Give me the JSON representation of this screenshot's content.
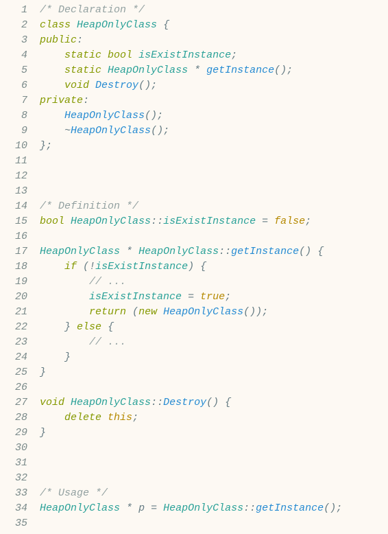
{
  "lines": [
    [
      {
        "c": "comment",
        "t": "/* Declaration */"
      }
    ],
    [
      {
        "c": "keyword",
        "t": "class"
      },
      {
        "c": "plain",
        "t": " "
      },
      {
        "c": "type",
        "t": "HeapOnlyClass"
      },
      {
        "c": "plain",
        "t": " "
      },
      {
        "c": "punct",
        "t": "{"
      }
    ],
    [
      {
        "c": "keyword",
        "t": "public"
      },
      {
        "c": "punct",
        "t": ":"
      }
    ],
    [
      {
        "c": "plain",
        "t": "    "
      },
      {
        "c": "keyword",
        "t": "static"
      },
      {
        "c": "plain",
        "t": " "
      },
      {
        "c": "keyword",
        "t": "bool"
      },
      {
        "c": "plain",
        "t": " "
      },
      {
        "c": "type",
        "t": "isExistInstance"
      },
      {
        "c": "punct",
        "t": ";"
      }
    ],
    [
      {
        "c": "plain",
        "t": "    "
      },
      {
        "c": "keyword",
        "t": "static"
      },
      {
        "c": "plain",
        "t": " "
      },
      {
        "c": "type",
        "t": "HeapOnlyClass"
      },
      {
        "c": "plain",
        "t": " "
      },
      {
        "c": "op",
        "t": "*"
      },
      {
        "c": "plain",
        "t": " "
      },
      {
        "c": "func",
        "t": "getInstance"
      },
      {
        "c": "punct",
        "t": "();"
      }
    ],
    [
      {
        "c": "plain",
        "t": "    "
      },
      {
        "c": "keyword",
        "t": "void"
      },
      {
        "c": "plain",
        "t": " "
      },
      {
        "c": "func",
        "t": "Destroy"
      },
      {
        "c": "punct",
        "t": "();"
      }
    ],
    [
      {
        "c": "keyword",
        "t": "private"
      },
      {
        "c": "punct",
        "t": ":"
      }
    ],
    [
      {
        "c": "plain",
        "t": "    "
      },
      {
        "c": "func",
        "t": "HeapOnlyClass"
      },
      {
        "c": "punct",
        "t": "();"
      }
    ],
    [
      {
        "c": "plain",
        "t": "    "
      },
      {
        "c": "op",
        "t": "~"
      },
      {
        "c": "func",
        "t": "HeapOnlyClass"
      },
      {
        "c": "punct",
        "t": "();"
      }
    ],
    [
      {
        "c": "punct",
        "t": "};"
      }
    ],
    [
      {
        "c": "plain",
        "t": ""
      }
    ],
    [
      {
        "c": "plain",
        "t": ""
      }
    ],
    [
      {
        "c": "plain",
        "t": ""
      }
    ],
    [
      {
        "c": "comment",
        "t": "/* Definition */"
      }
    ],
    [
      {
        "c": "keyword",
        "t": "bool"
      },
      {
        "c": "plain",
        "t": " "
      },
      {
        "c": "type",
        "t": "HeapOnlyClass"
      },
      {
        "c": "punct",
        "t": "::"
      },
      {
        "c": "type",
        "t": "isExistInstance"
      },
      {
        "c": "plain",
        "t": " "
      },
      {
        "c": "op",
        "t": "="
      },
      {
        "c": "plain",
        "t": " "
      },
      {
        "c": "const",
        "t": "false"
      },
      {
        "c": "punct",
        "t": ";"
      }
    ],
    [
      {
        "c": "plain",
        "t": ""
      }
    ],
    [
      {
        "c": "type",
        "t": "HeapOnlyClass"
      },
      {
        "c": "plain",
        "t": " "
      },
      {
        "c": "op",
        "t": "*"
      },
      {
        "c": "plain",
        "t": " "
      },
      {
        "c": "type",
        "t": "HeapOnlyClass"
      },
      {
        "c": "punct",
        "t": "::"
      },
      {
        "c": "func",
        "t": "getInstance"
      },
      {
        "c": "punct",
        "t": "()"
      },
      {
        "c": "plain",
        "t": " "
      },
      {
        "c": "punct",
        "t": "{"
      }
    ],
    [
      {
        "c": "plain",
        "t": "    "
      },
      {
        "c": "keyword",
        "t": "if"
      },
      {
        "c": "plain",
        "t": " "
      },
      {
        "c": "punct",
        "t": "("
      },
      {
        "c": "op",
        "t": "!"
      },
      {
        "c": "type",
        "t": "isExistInstance"
      },
      {
        "c": "punct",
        "t": ")"
      },
      {
        "c": "plain",
        "t": " "
      },
      {
        "c": "punct",
        "t": "{"
      }
    ],
    [
      {
        "c": "plain",
        "t": "        "
      },
      {
        "c": "comment",
        "t": "// ..."
      }
    ],
    [
      {
        "c": "plain",
        "t": "        "
      },
      {
        "c": "type",
        "t": "isExistInstance"
      },
      {
        "c": "plain",
        "t": " "
      },
      {
        "c": "op",
        "t": "="
      },
      {
        "c": "plain",
        "t": " "
      },
      {
        "c": "const",
        "t": "true"
      },
      {
        "c": "punct",
        "t": ";"
      }
    ],
    [
      {
        "c": "plain",
        "t": "        "
      },
      {
        "c": "keyword",
        "t": "return"
      },
      {
        "c": "plain",
        "t": " "
      },
      {
        "c": "punct",
        "t": "("
      },
      {
        "c": "keyword",
        "t": "new"
      },
      {
        "c": "plain",
        "t": " "
      },
      {
        "c": "func",
        "t": "HeapOnlyClass"
      },
      {
        "c": "punct",
        "t": "());"
      }
    ],
    [
      {
        "c": "plain",
        "t": "    "
      },
      {
        "c": "punct",
        "t": "}"
      },
      {
        "c": "plain",
        "t": " "
      },
      {
        "c": "keyword",
        "t": "else"
      },
      {
        "c": "plain",
        "t": " "
      },
      {
        "c": "punct",
        "t": "{"
      }
    ],
    [
      {
        "c": "plain",
        "t": "        "
      },
      {
        "c": "comment",
        "t": "// ..."
      }
    ],
    [
      {
        "c": "plain",
        "t": "    "
      },
      {
        "c": "punct",
        "t": "}"
      }
    ],
    [
      {
        "c": "punct",
        "t": "}"
      }
    ],
    [
      {
        "c": "plain",
        "t": ""
      }
    ],
    [
      {
        "c": "keyword",
        "t": "void"
      },
      {
        "c": "plain",
        "t": " "
      },
      {
        "c": "type",
        "t": "HeapOnlyClass"
      },
      {
        "c": "punct",
        "t": "::"
      },
      {
        "c": "func",
        "t": "Destroy"
      },
      {
        "c": "punct",
        "t": "()"
      },
      {
        "c": "plain",
        "t": " "
      },
      {
        "c": "punct",
        "t": "{"
      }
    ],
    [
      {
        "c": "plain",
        "t": "    "
      },
      {
        "c": "keyword",
        "t": "delete"
      },
      {
        "c": "plain",
        "t": " "
      },
      {
        "c": "this",
        "t": "this"
      },
      {
        "c": "punct",
        "t": ";"
      }
    ],
    [
      {
        "c": "punct",
        "t": "}"
      }
    ],
    [
      {
        "c": "plain",
        "t": ""
      }
    ],
    [
      {
        "c": "plain",
        "t": ""
      }
    ],
    [
      {
        "c": "plain",
        "t": ""
      }
    ],
    [
      {
        "c": "comment",
        "t": "/* Usage */"
      }
    ],
    [
      {
        "c": "type",
        "t": "HeapOnlyClass"
      },
      {
        "c": "plain",
        "t": " "
      },
      {
        "c": "op",
        "t": "*"
      },
      {
        "c": "plain",
        "t": " p "
      },
      {
        "c": "op",
        "t": "="
      },
      {
        "c": "plain",
        "t": " "
      },
      {
        "c": "type",
        "t": "HeapOnlyClass"
      },
      {
        "c": "punct",
        "t": "::"
      },
      {
        "c": "func",
        "t": "getInstance"
      },
      {
        "c": "punct",
        "t": "();"
      }
    ],
    [
      {
        "c": "plain",
        "t": ""
      }
    ]
  ]
}
